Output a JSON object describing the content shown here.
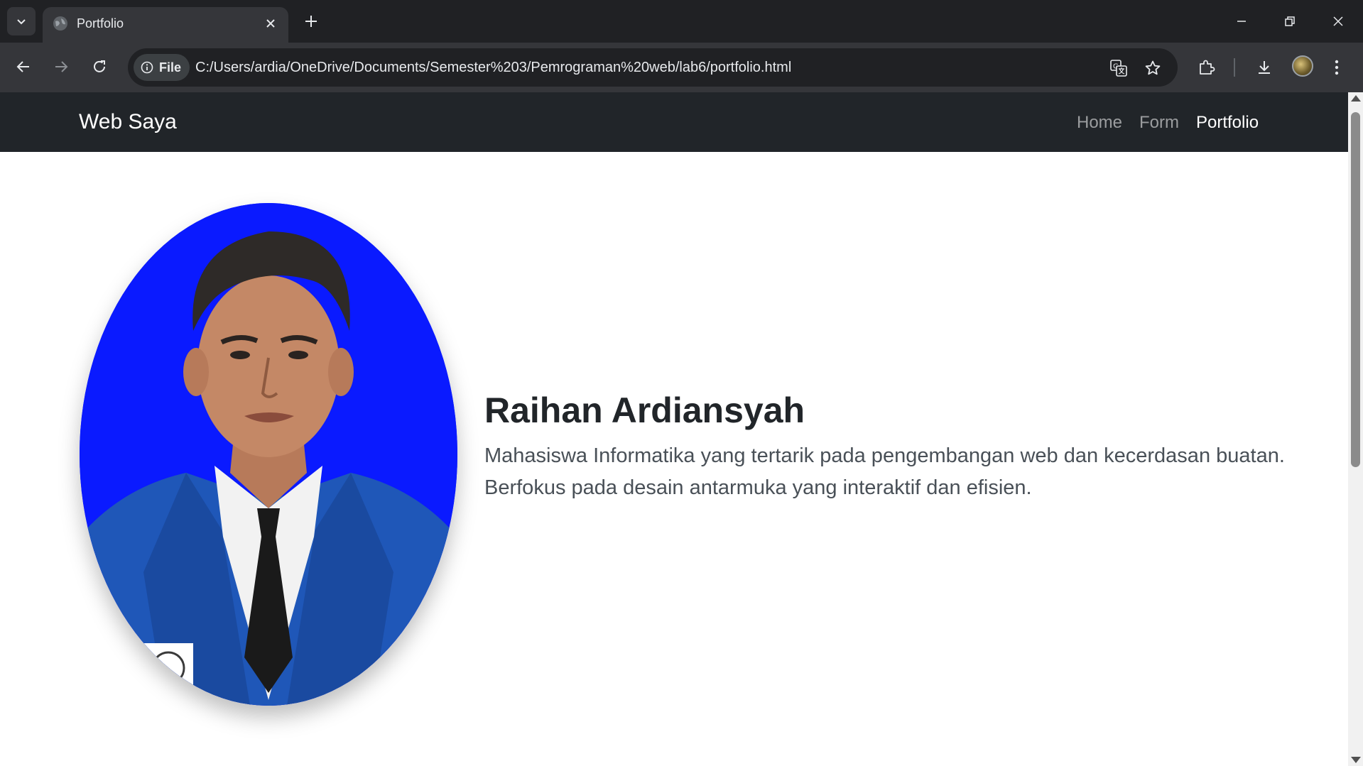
{
  "browser": {
    "tab_title": "Portfolio",
    "url_scheme_label": "File",
    "url": "C:/Users/ardia/OneDrive/Documents/Semester%203/Pemrograman%20web/lab6/portfolio.html"
  },
  "site": {
    "brand": "Web Saya",
    "nav": [
      {
        "label": "Home",
        "active": false
      },
      {
        "label": "Form",
        "active": false
      },
      {
        "label": "Portfolio",
        "active": true
      }
    ]
  },
  "hero": {
    "name": "Raihan Ardiansyah",
    "description": "Mahasiswa Informatika yang tertarik pada pengembangan web dan kecerdasan buatan. Berfokus pada desain antarmuka yang interaktif dan efisien.",
    "photo_background": "#0a1aff",
    "jacket_color": "#1f57b8"
  },
  "colors": {
    "navbar": "#212529",
    "chrome_dark": "#202124",
    "chrome_toolbar": "#35363a"
  }
}
